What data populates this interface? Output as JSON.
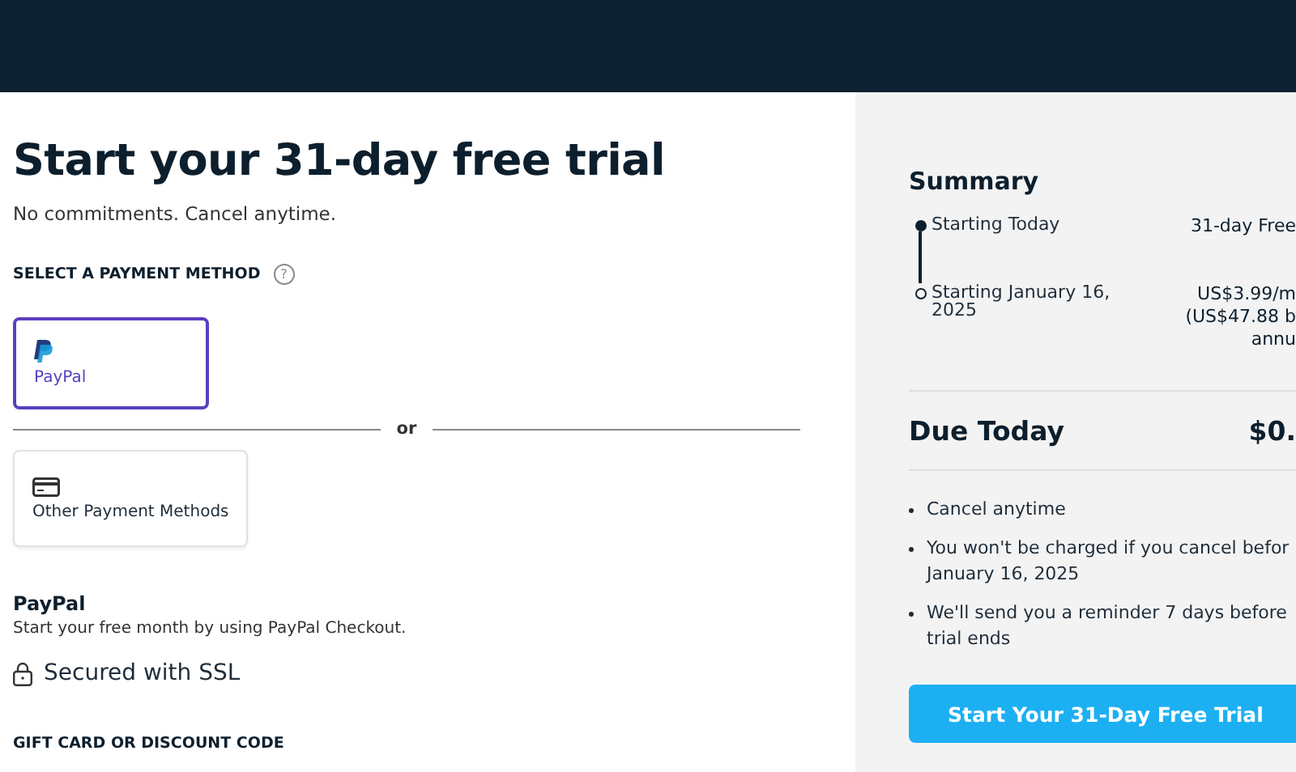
{
  "title": "Start your 31-day free trial",
  "subtitle": "No commitments. Cancel anytime.",
  "payment_section": {
    "label": "SELECT A PAYMENT METHOD",
    "help_icon": "?",
    "methods": [
      {
        "kind": "paypal",
        "label": "PayPal",
        "selected": true
      },
      {
        "kind": "card",
        "label": "Other Payment Methods",
        "selected": false
      }
    ],
    "divider": "or"
  },
  "method_info": {
    "heading": "PayPal",
    "description": "Start your free month by using PayPal Checkout."
  },
  "security": "Secured with SSL",
  "gift_card_label": "GIFT CARD OR DISCOUNT CODE",
  "summary": {
    "title": "Summary",
    "timeline": [
      {
        "label": "Starting Today",
        "value_lines": [
          "31-day Free"
        ],
        "active": true
      },
      {
        "label": "Starting January 16, 2025",
        "value_lines": [
          "US$3.99/m",
          "(US$47.88 b",
          "annu"
        ],
        "active": false
      }
    ],
    "due_label": "Due Today",
    "due_value": "$0.",
    "bullets": [
      {
        "lines": [
          "Cancel anytime"
        ]
      },
      {
        "lines": [
          "You won't be charged if you cancel befor",
          "January 16, 2025"
        ]
      },
      {
        "lines": [
          "We'll send you a reminder 7 days before",
          "trial ends"
        ]
      }
    ],
    "button": "Start Your 31-Day Free Trial"
  }
}
